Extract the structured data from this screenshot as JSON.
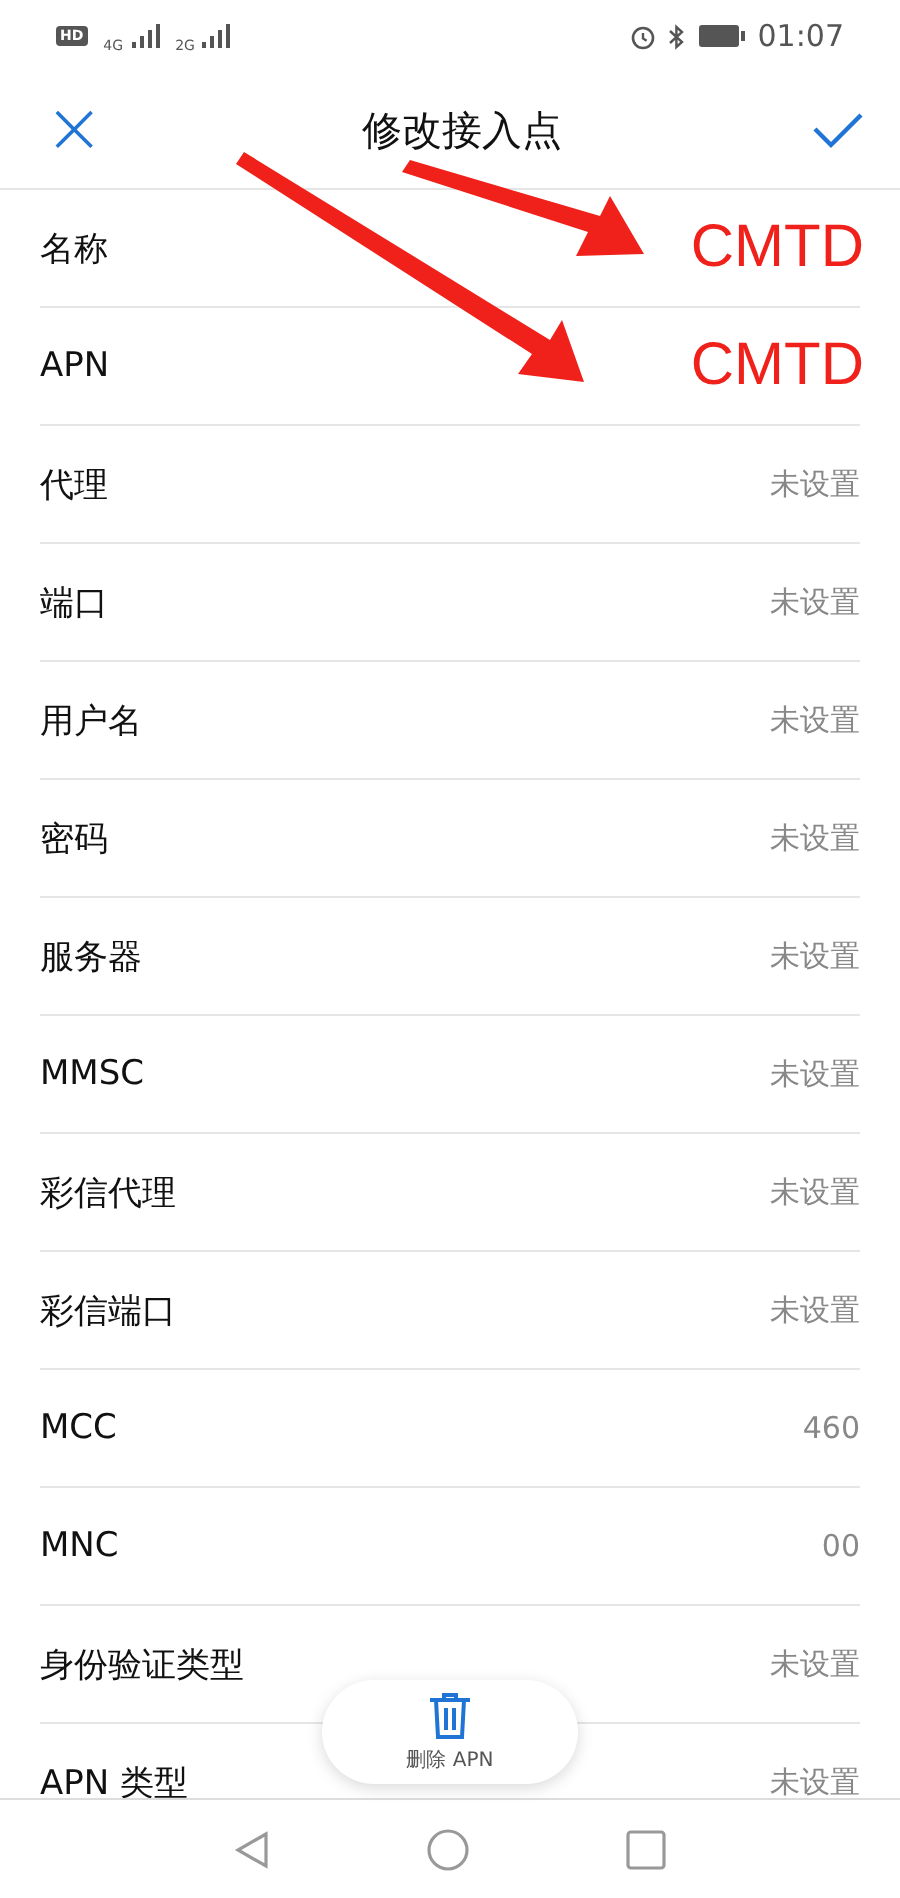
{
  "status_bar": {
    "hd": "HD",
    "networks": [
      "4G",
      "2G"
    ],
    "time": "01:07"
  },
  "header": {
    "close": "×",
    "title": "修改接入点"
  },
  "rows": [
    {
      "label": "名称",
      "value": "CMTD",
      "kind": "annotation"
    },
    {
      "label": "APN",
      "value": "CMTD",
      "kind": "annotation"
    },
    {
      "label": "代理",
      "value": "未设置",
      "kind": "plain"
    },
    {
      "label": "端口",
      "value": "未设置",
      "kind": "plain"
    },
    {
      "label": "用户名",
      "value": "未设置",
      "kind": "plain"
    },
    {
      "label": "密码",
      "value": "未设置",
      "kind": "plain"
    },
    {
      "label": "服务器",
      "value": "未设置",
      "kind": "plain"
    },
    {
      "label": "MMSC",
      "value": "未设置",
      "kind": "plain"
    },
    {
      "label": "彩信代理",
      "value": "未设置",
      "kind": "plain"
    },
    {
      "label": "彩信端口",
      "value": "未设置",
      "kind": "plain"
    },
    {
      "label": "MCC",
      "value": "460",
      "kind": "plain"
    },
    {
      "label": "MNC",
      "value": "00",
      "kind": "plain"
    },
    {
      "label": "身份验证类型",
      "value": "未设置",
      "kind": "plain"
    },
    {
      "label": "APN 类型",
      "value": "未设置",
      "kind": "plain"
    }
  ],
  "delete_button": {
    "label": "删除 APN"
  },
  "annotations": [
    {
      "kind": "arrow"
    },
    {
      "kind": "arrow"
    }
  ]
}
